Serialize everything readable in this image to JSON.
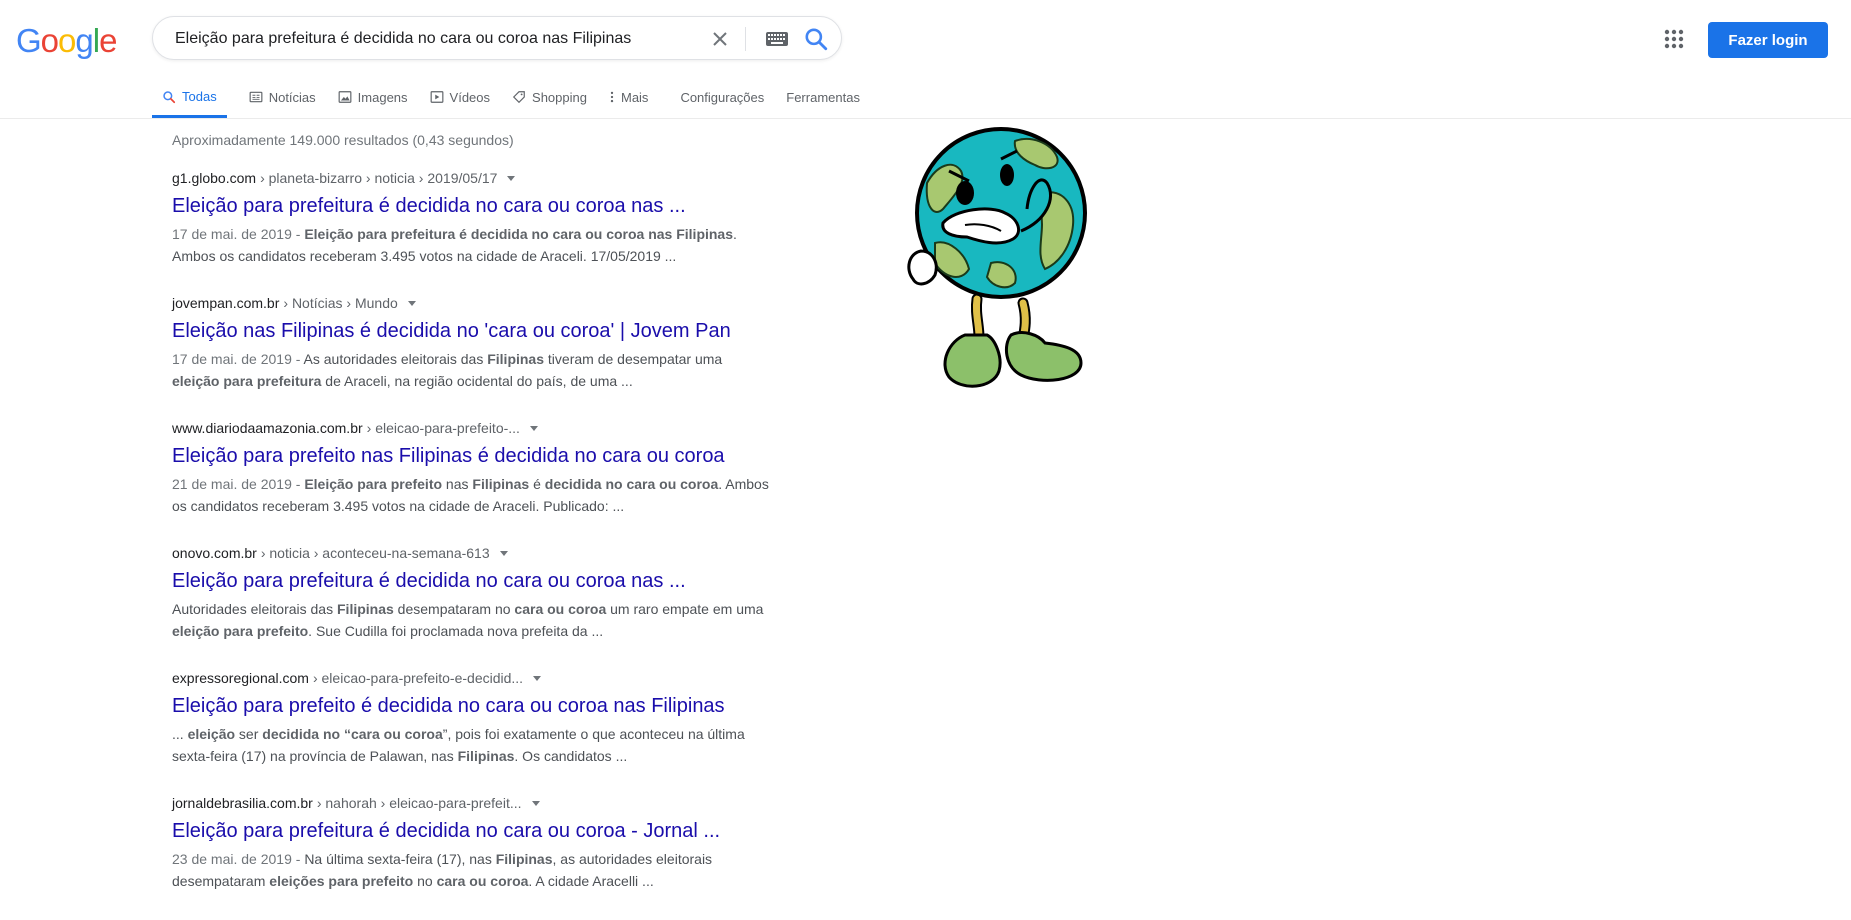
{
  "logo": {
    "letters": [
      "G",
      "o",
      "o",
      "g",
      "l",
      "e"
    ],
    "colors": [
      "#4285F4",
      "#EA4335",
      "#FBBC05",
      "#4285F4",
      "#34A853",
      "#EA4335"
    ]
  },
  "search": {
    "query": "Eleição para prefeitura é decidida no cara ou coroa nas Filipinas"
  },
  "header": {
    "login_label": "Fazer login"
  },
  "tabs": [
    {
      "label": "Todas",
      "icon": "search-icon"
    },
    {
      "label": "Notícias",
      "icon": "news-icon"
    },
    {
      "label": "Imagens",
      "icon": "image-icon"
    },
    {
      "label": "Vídeos",
      "icon": "video-icon"
    },
    {
      "label": "Shopping",
      "icon": "tag-icon"
    },
    {
      "label": "Mais",
      "icon": "more-icon"
    },
    {
      "label": "Configurações"
    },
    {
      "label": "Ferramentas"
    }
  ],
  "stats": "Aproximadamente 149.000 resultados (0,43 segundos)",
  "results": [
    {
      "domain": "g1.globo.com",
      "path": "› planeta-bizarro › noticia › 2019/05/17",
      "title": "Eleição para prefeitura é decidida no cara ou coroa nas ...",
      "snippet": "<span class='date'>17 de mai. de 2019 - </span><b>Eleição para prefeitura é decidida no cara ou coroa nas Filipinas</b>. Ambos os candidatos receberam 3.495 votos na cidade de Araceli. 17/05/2019 ..."
    },
    {
      "domain": "jovempan.com.br",
      "path": "› Notícias › Mundo",
      "title": "Eleição nas Filipinas é decidida no 'cara ou coroa' | Jovem Pan",
      "snippet": "<span class='date'>17 de mai. de 2019 - </span>As autoridades eleitorais das <b>Filipinas</b> tiveram de desempatar uma <b>eleição para prefeitura</b> de Araceli, na região ocidental do país, de uma ..."
    },
    {
      "domain": "www.diariodaamazonia.com.br",
      "path": "› eleicao-para-prefeito-...",
      "title": "Eleição para prefeito nas Filipinas é decidida no cara ou coroa",
      "snippet": "<span class='date'>21 de mai. de 2019 - </span><b>Eleição para prefeito</b> nas <b>Filipinas</b> é <b>decidida no cara ou coroa</b>. Ambos os candidatos receberam 3.495 votos na cidade de Araceli. Publicado: ..."
    },
    {
      "domain": "onovo.com.br",
      "path": "› noticia › aconteceu-na-semana-613",
      "title": "Eleição para prefeitura é decidida no cara ou coroa nas ...",
      "snippet": "Autoridades eleitorais das <b>Filipinas</b> desempataram no <b>cara ou coroa</b> um raro empate em uma <b>eleição para prefeito</b>. Sue Cudilla foi proclamada nova prefeita da ..."
    },
    {
      "domain": "expressoregional.com",
      "path": "› eleicao-para-prefeito-e-decidid...",
      "title": "Eleição para prefeito é decidida no cara ou coroa nas Filipinas",
      "snippet": "... <b>eleição</b> ser <b>decidida no “cara ou coroa</b>”, pois foi exatamente o que aconteceu na última sexta-feira (17) na província de Palawan, nas <b>Filipinas</b>. Os candidatos ..."
    },
    {
      "domain": "jornaldebrasilia.com.br",
      "path": "› nahorah › eleicao-para-prefeit...",
      "title": "Eleição para prefeitura é decidida no cara ou coroa - Jornal ...",
      "snippet": "<span class='date'>23 de mai. de 2019 - </span>Na última sexta-feira (17), nas <b>Filipinas</b>, as autoridades eleitorais desempataram <b>eleições para prefeito</b> no <b>cara ou coroa</b>. A cidade Aracelli ..."
    }
  ]
}
